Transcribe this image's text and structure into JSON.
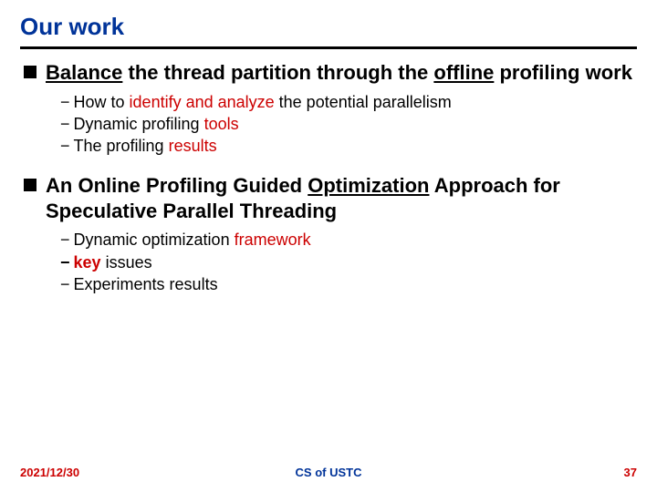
{
  "title": "Our work",
  "items": [
    {
      "prefix": "Balance",
      "mid1": " the thread partition through the ",
      "u2": "offline",
      "mid2": " profiling work",
      "subs": [
        {
          "pre": "How to ",
          "red": "identify and analyze",
          "post": " the potential parallelism"
        },
        {
          "pre": "Dynamic profiling ",
          "red": "tools",
          "post": ""
        },
        {
          "pre": "The profiling ",
          "red": "results",
          "post": ""
        }
      ]
    },
    {
      "prefix_plain": "An ",
      "b1": "Online",
      "mid1": " Profiling Guided ",
      "u2": "Optimization",
      "mid2": " Approach for Speculative Parallel Threading",
      "subs": [
        {
          "pre": "Dynamic optimization ",
          "red": "framework",
          "post": ""
        },
        {
          "pre": "",
          "red": "key",
          "post": " issues",
          "redbold": true
        },
        {
          "pre": "Experiments results",
          "red": "",
          "post": ""
        }
      ]
    }
  ],
  "footer": {
    "date": "2021/12/30",
    "center": "CS of USTC",
    "page": "37"
  }
}
